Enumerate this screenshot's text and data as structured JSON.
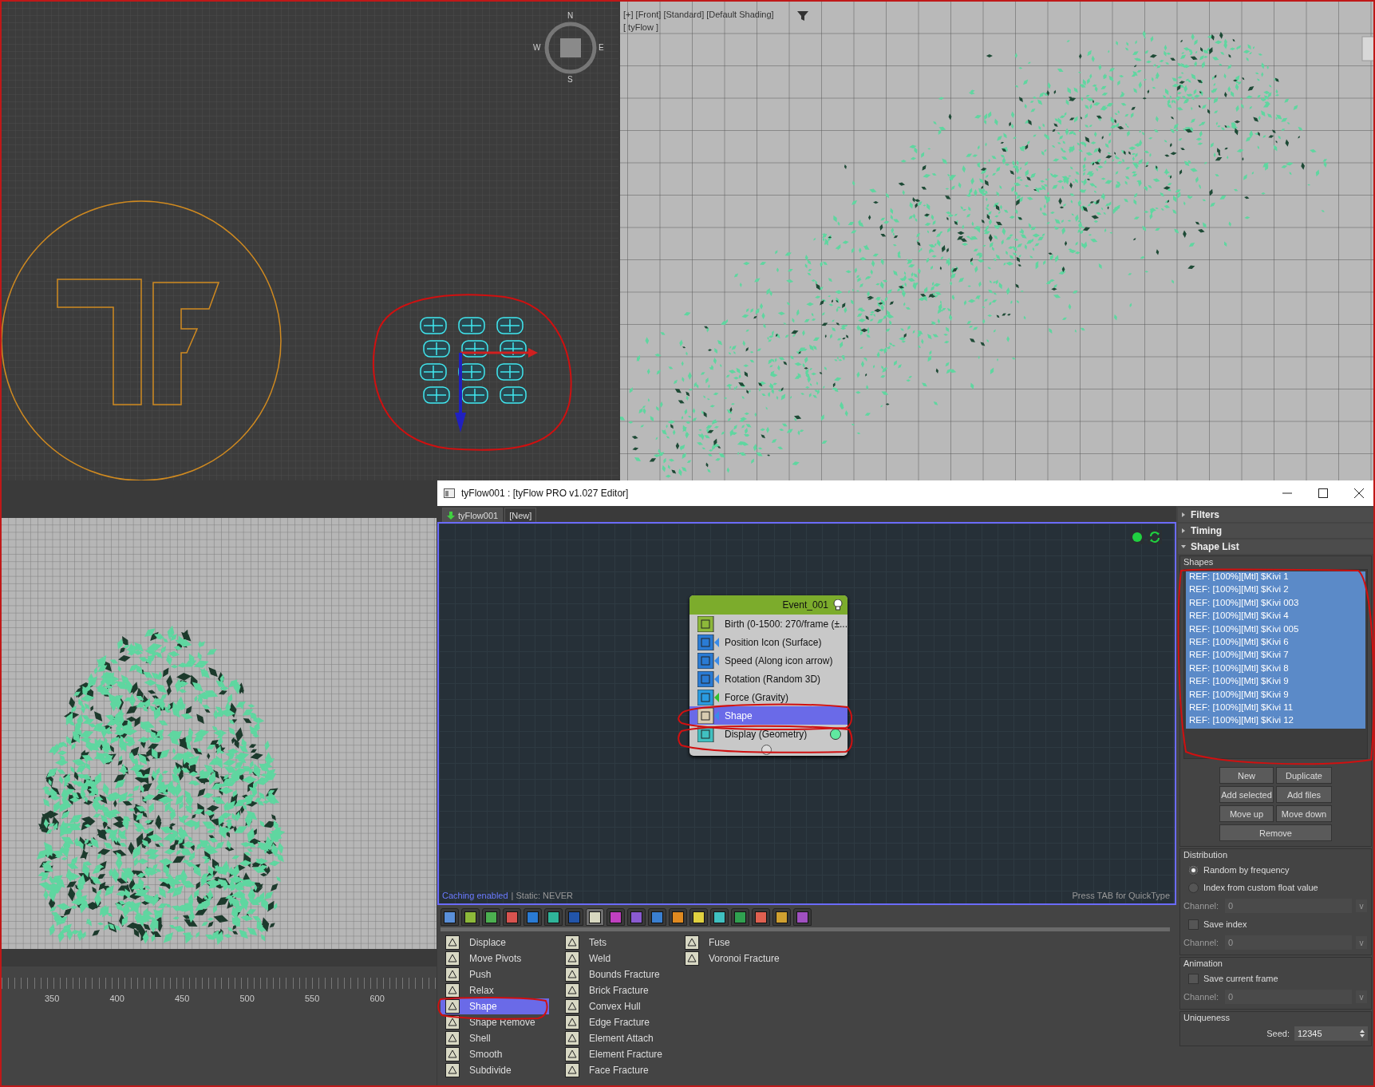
{
  "top_view": {
    "compass": [
      "N",
      "E",
      "S",
      "W"
    ]
  },
  "front_view": {
    "labels": [
      "[+] [Front] [Standard] [Default Shading]",
      "[ tyFlow ]"
    ]
  },
  "timeline": {
    "ticks": [
      "350",
      "400",
      "450",
      "500",
      "550",
      "600"
    ]
  },
  "editor": {
    "title": "tyFlow001 : [tyFlow PRO v1.027 Editor]",
    "tabs": [
      {
        "label": "tyFlow001",
        "selected": true
      },
      {
        "label": "[New]",
        "selected": false
      }
    ],
    "event": {
      "title": "Event_001",
      "operators": [
        {
          "name": "Birth (0-1500: 270/frame (±...",
          "kind": "birth",
          "selected": false
        },
        {
          "name": "Position Icon (Surface)",
          "kind": "operator",
          "selected": false
        },
        {
          "name": "Speed (Along icon arrow)",
          "kind": "operator",
          "selected": false
        },
        {
          "name": "Rotation (Random 3D)",
          "kind": "operator",
          "selected": false
        },
        {
          "name": "Force (Gravity)",
          "kind": "force",
          "selected": false
        },
        {
          "name": "Shape",
          "kind": "shape",
          "selected": true
        },
        {
          "name": "Display (Geometry)",
          "kind": "display",
          "selected": false
        }
      ]
    },
    "status": {
      "caching": "Caching enabled",
      "static": "| Static: NEVER",
      "hint": "Press TAB for QuickType"
    },
    "toolbar": [
      {
        "color": "#5a8fd8",
        "selected": false
      },
      {
        "color": "#8db83a",
        "selected": false
      },
      {
        "color": "#4caf50",
        "selected": false
      },
      {
        "color": "#d9534f",
        "selected": false
      },
      {
        "color": "#2a7bd4",
        "selected": false
      },
      {
        "color": "#2fb59a",
        "selected": false
      },
      {
        "color": "#2255aa",
        "selected": false
      },
      {
        "color": "#d8d8c0",
        "selected": true
      },
      {
        "color": "#c040c0",
        "selected": false
      },
      {
        "color": "#8a5ad0",
        "selected": false
      },
      {
        "color": "#3a7fd0",
        "selected": false
      },
      {
        "color": "#e08a20",
        "selected": false
      },
      {
        "color": "#e0d040",
        "selected": false
      },
      {
        "color": "#40c0c0",
        "selected": false
      },
      {
        "color": "#30a050",
        "selected": false
      },
      {
        "color": "#e06050",
        "selected": false
      },
      {
        "color": "#d0a030",
        "selected": false
      },
      {
        "color": "#a050c0",
        "selected": false
      }
    ],
    "palette": [
      [
        {
          "label": "Displace",
          "selected": false
        },
        {
          "label": "Move Pivots",
          "selected": false
        },
        {
          "label": "Push",
          "selected": false
        },
        {
          "label": "Relax",
          "selected": false
        },
        {
          "label": "Shape",
          "selected": true
        },
        {
          "label": "Shape Remove",
          "selected": false
        },
        {
          "label": "Shell",
          "selected": false
        },
        {
          "label": "Smooth",
          "selected": false
        },
        {
          "label": "Subdivide",
          "selected": false
        }
      ],
      [
        {
          "label": "Tets",
          "selected": false
        },
        {
          "label": "Weld",
          "selected": false
        },
        {
          "label": "Bounds Fracture",
          "selected": false
        },
        {
          "label": "Brick Fracture",
          "selected": false
        },
        {
          "label": "Convex Hull",
          "selected": false
        },
        {
          "label": "Edge Fracture",
          "selected": false
        },
        {
          "label": "Element Attach",
          "selected": false
        },
        {
          "label": "Element Fracture",
          "selected": false
        },
        {
          "label": "Face Fracture",
          "selected": false
        }
      ],
      [
        {
          "label": "Fuse",
          "selected": false
        },
        {
          "label": "Voronoi Fracture",
          "selected": false
        }
      ]
    ],
    "rollouts": [
      {
        "title": "Filters",
        "expanded": false
      },
      {
        "title": "Timing",
        "expanded": false
      },
      {
        "title": "Shape List",
        "expanded": true
      }
    ],
    "shapes": {
      "title": "Shapes",
      "items": [
        {
          "label": "REF: [100%][Mtl] $Kivi 1",
          "selected": true
        },
        {
          "label": "REF: [100%][Mtl] $Kivi 2",
          "selected": true
        },
        {
          "label": "REF: [100%][Mtl] $Kivi 003",
          "selected": true
        },
        {
          "label": "REF: [100%][Mtl] $Kivi 4",
          "selected": true
        },
        {
          "label": "REF: [100%][Mtl] $Kivi 005",
          "selected": true
        },
        {
          "label": "REF: [100%][Mtl] $Kivi 6",
          "selected": true
        },
        {
          "label": "REF: [100%][Mtl] $Kivi 7",
          "selected": true
        },
        {
          "label": "REF: [100%][Mtl] $Kivi 8",
          "selected": true
        },
        {
          "label": "REF: [100%][Mtl] $Kivi 9",
          "selected": true
        },
        {
          "label": "REF: [100%][Mtl] $Kivi 9",
          "selected": true
        },
        {
          "label": "REF: [100%][Mtl] $Kivi 11",
          "selected": true
        },
        {
          "label": "REF: [100%][Mtl] $Kivi 12",
          "selected": true
        }
      ],
      "buttons": [
        "New",
        "Duplicate",
        "Add selected",
        "Add files",
        "Move up",
        "Move down",
        "Remove"
      ]
    },
    "groups": [
      {
        "title": "Distribution",
        "controls": [
          {
            "kind": "radio",
            "label": "Random by frequency",
            "selected": true
          },
          {
            "kind": "radio",
            "label": "Index from custom float value",
            "selected": false
          },
          {
            "kind": "field",
            "label": "Channel:",
            "value": "0",
            "button": "v",
            "disabled": true
          },
          {
            "kind": "checkbox",
            "label": "Save index",
            "checked": false
          },
          {
            "kind": "field",
            "label": "Channel:",
            "value": "0",
            "button": "v",
            "disabled": true
          }
        ]
      },
      {
        "title": "Animation",
        "controls": [
          {
            "kind": "checkbox",
            "label": "Save current frame",
            "checked": false
          },
          {
            "kind": "field",
            "label": "Channel:",
            "value": "0",
            "button": "v",
            "disabled": true
          }
        ]
      },
      {
        "title": "Uniqueness",
        "controls": [
          {
            "kind": "spinner",
            "label": "Seed:",
            "value": "12345"
          }
        ]
      }
    ]
  }
}
